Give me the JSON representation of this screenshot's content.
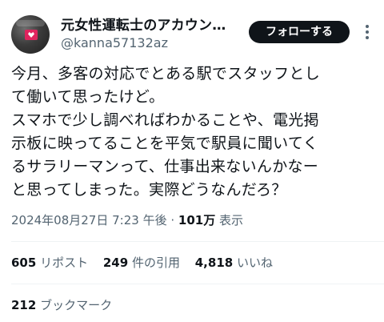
{
  "author": {
    "display_name": "元女性運転士のアカウン…",
    "handle": "@kanna57132az",
    "avatar_icon": "avatar-heart-icon"
  },
  "header": {
    "follow_label": "フォローする",
    "more_icon": "more-vertical-icon"
  },
  "tweet": {
    "lines": [
      "今月、多客の対応でとある駅でスタッフとし",
      "て働いて思ったけど。",
      "スマホで少し調べればわかることや、電光掲",
      "示板に映ってることを平気で駅員に聞いてく",
      "るサラリーマンって、仕事出来ないんかなー",
      "と思ってしまった。実際どうなんだろ？"
    ]
  },
  "meta": {
    "timestamp": "2024年08月27日 7:23 午後",
    "separator": " · ",
    "views_count": "101万",
    "views_label": " 表示"
  },
  "stats": {
    "reposts_count": "605",
    "reposts_label": " リポスト",
    "quotes_count": "249",
    "quotes_label": " 件の引用",
    "likes_count": "4,818",
    "likes_label": " いいね",
    "bookmarks_count": "212",
    "bookmarks_label": " ブックマーク"
  },
  "colors": {
    "text_primary": "#0f1419",
    "text_secondary": "#536471",
    "follow_bg": "#0f1419",
    "divider": "#eff3f4"
  }
}
